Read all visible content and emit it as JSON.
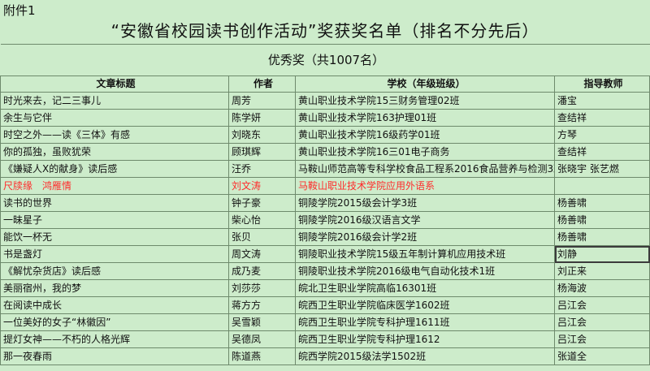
{
  "annex": "附件1",
  "title": "“安徽省校园读书创作活动”奖获奖名单（排名不分先后）",
  "award": "优秀奖（共1007名）",
  "headers": [
    "文章标题",
    "作者",
    "学校（年级班级）",
    "指导教师"
  ],
  "colors": {
    "background": "#cdeccb",
    "grid": "#6e8a6c",
    "highlight_text": "#ff2b2b"
  },
  "rows": [
    [
      "时光来去，记二三事儿",
      "周芳",
      "黄山职业技术学院15三财务管理02班",
      "潘宝"
    ],
    [
      "余生与它伴",
      "陈学妍",
      "黄山职业技术学院163护理01班",
      "查结祥"
    ],
    [
      "时空之外——读《三体》有感",
      "刘晓东",
      "黄山职业技术学院16级药学01班",
      "方琴"
    ],
    [
      "你的孤独，虽败犹荣",
      "顾琪辉",
      "黄山职业技术学院16三01电子商务",
      "查结祥"
    ],
    [
      "《嫌疑人X的献身》读后感",
      "汪乔",
      "马鞍山师范高等专科学校食品工程系2016食品营养与检测3班",
      "张晓宇 张艺燃"
    ],
    [
      "尺牍缘　鸿雁情",
      "刘文涛",
      "马鞍山职业技术学院应用外语系",
      ""
    ],
    [
      "读书的世界",
      "钟子豪",
      "铜陵学院2015级会计学3班",
      "杨善啸"
    ],
    [
      "一昧星子",
      "柴心怡",
      "铜陵学院2016级汉语言文学",
      "杨善啸"
    ],
    [
      "能饮一杯无",
      "张贝",
      "铜陵学院2016级会计学2班",
      "杨善啸"
    ],
    [
      "书是盏灯",
      "周文涛",
      "铜陵职业技术学院15级五年制计算机应用技术班",
      "刘静"
    ],
    [
      "《解忧杂货店》读后感",
      "成乃麦",
      "铜陵职业技术学院2016级电气自动化技术1班",
      "刘正来"
    ],
    [
      "美丽宿州，我的梦",
      "刘莎莎",
      "皖北卫生职业学院高临16301班",
      "杨海波"
    ],
    [
      "在阅读中成长",
      "蒋方方",
      "皖西卫生职业学院临床医学1602班",
      "吕江会"
    ],
    [
      "一位美好的女子“林徽因”",
      "吴雪颖",
      "皖西卫生职业学院专科护理1611班",
      "吕江会"
    ],
    [
      "提灯女神——不朽的人格光辉",
      "吴德凤",
      "皖西卫生职业学院专科护理1612",
      "吕江会"
    ],
    [
      "那一夜春雨",
      "陈道燕",
      "皖西学院2015级法学1502班",
      "张道全"
    ]
  ]
}
